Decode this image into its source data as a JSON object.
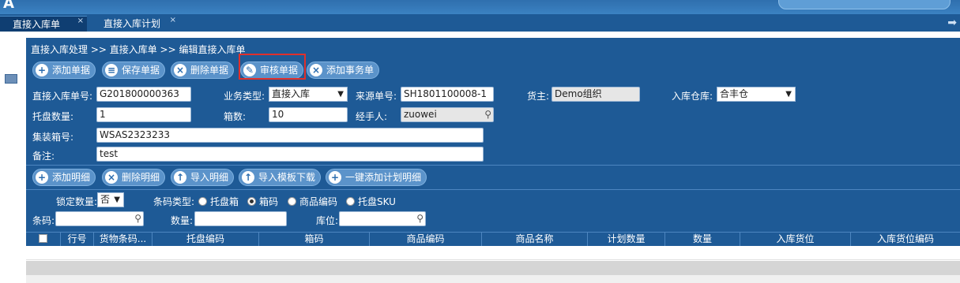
{
  "tabs": [
    {
      "label": "直接入库单",
      "close": "×"
    },
    {
      "label": "直接入库计划",
      "close": "×"
    }
  ],
  "breadcrumb": "直接入库处理 >> 直接入库单 >> 编辑直接入库单",
  "toolbar": {
    "add": "添加单据",
    "save": "保存单据",
    "delete": "删除单据",
    "audit": "审核单据",
    "add_affair": "添加事务单"
  },
  "form": {
    "order_no_label": "直接入库单号:",
    "order_no_value": "G201800000363",
    "biz_type_label": "业务类型:",
    "biz_type_value": "直接入库",
    "source_no_label": "来源单号:",
    "source_no_value": "SH1801100008-1",
    "owner_label": "货主:",
    "owner_value": "Demo组织",
    "warehouse_label": "入库仓库:",
    "warehouse_value": "合丰仓",
    "pallet_qty_label": "托盘数量:",
    "pallet_qty_value": "1",
    "box_qty_label": "箱数:",
    "box_qty_value": "10",
    "handler_label": "经手人:",
    "handler_value": "zuowei",
    "container_label": "集装箱号:",
    "container_value": "WSAS2323233",
    "remark_label": "备注:",
    "remark_value": "test"
  },
  "detail_toolbar": {
    "add_detail": "添加明细",
    "delete_detail": "删除明细",
    "import_detail": "导入明细",
    "download_template": "导入模板下载",
    "add_plan_detail": "一键添加计划明细"
  },
  "filters": {
    "lock_qty_label": "锁定数量:",
    "lock_qty_value": "否",
    "barcode_type_label": "条码类型:",
    "barcode_options": [
      {
        "label": "托盘箱",
        "selected": false
      },
      {
        "label": "箱码",
        "selected": true
      },
      {
        "label": "商品编码",
        "selected": false
      },
      {
        "label": "托盘SKU",
        "selected": false
      }
    ],
    "barcode_label": "条码:",
    "qty_label": "数量:",
    "location_label": "库位:"
  },
  "table": {
    "columns": [
      "",
      "行号",
      "货物条码...",
      "托盘编码",
      "箱码",
      "商品编码",
      "商品名称",
      "计划数量",
      "数量",
      "入库货位",
      "入库货位编码"
    ]
  },
  "colors": {
    "panel": "#1e5a96",
    "button": "#5b93ca",
    "highlight": "#e0302b"
  }
}
